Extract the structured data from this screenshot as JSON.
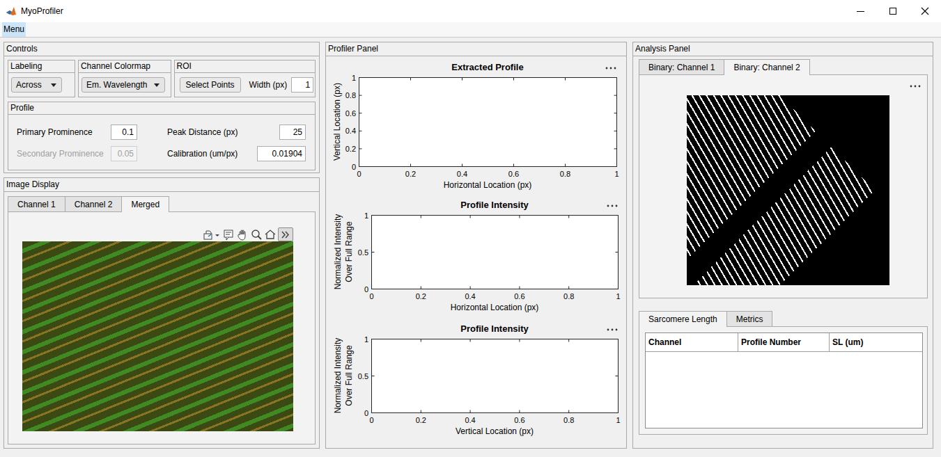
{
  "window": {
    "title": "MyoProfiler"
  },
  "menu": [
    {
      "label": "Menu",
      "selected": true
    }
  ],
  "controls": {
    "title": "Controls",
    "labeling": {
      "title": "Labeling",
      "value": "Across"
    },
    "colormap": {
      "title": "Channel Colormap",
      "value": "Em. Wavelength"
    },
    "roi": {
      "title": "ROI",
      "button": "Select Points",
      "width_label": "Width (px)",
      "width_value": "1"
    },
    "profile": {
      "title": "Profile",
      "fields": [
        {
          "label": "Primary Prominence",
          "value": "0.1",
          "disabled": false
        },
        {
          "label": "Peak Distance (px)",
          "value": "25",
          "disabled": false
        },
        {
          "label": "Secondary Prominence",
          "value": "0.05",
          "disabled": true
        },
        {
          "label": "Calibration (um/px)",
          "value": "0.01904",
          "disabled": false
        }
      ]
    }
  },
  "image_display": {
    "title": "Image Display",
    "tabs": [
      {
        "label": "Channel 1",
        "selected": false
      },
      {
        "label": "Channel 2",
        "selected": false
      },
      {
        "label": "Merged",
        "selected": true
      }
    ]
  },
  "profiler": {
    "title": "Profiler Panel",
    "charts": [
      {
        "title": "Extracted Profile",
        "xlabel": "Horizontal Location (px)",
        "ylabel": [
          "Vertical Location (px)"
        ],
        "xticks": [
          "0",
          "0.2",
          "0.4",
          "0.6",
          "0.8",
          "1"
        ],
        "yticks": [
          "0",
          "0.2",
          "0.4",
          "0.6",
          "0.8",
          "1"
        ],
        "series": []
      },
      {
        "title": "Profile Intensity",
        "xlabel": "Horizontal Location (px)",
        "ylabel": [
          "Normalized Intensity",
          "Over Full Range"
        ],
        "xticks": [
          "0",
          "0.2",
          "0.4",
          "0.6",
          "0.8",
          "1"
        ],
        "yticks": [
          "0",
          "0.5",
          "1"
        ],
        "series": []
      },
      {
        "title": "Profile Intensity",
        "xlabel": "Vertical Location (px)",
        "ylabel": [
          "Normalized Intensity",
          "Over Full Range"
        ],
        "xticks": [
          "0",
          "0.2",
          "0.4",
          "0.6",
          "0.8",
          "1"
        ],
        "yticks": [
          "0",
          "0.5",
          "1"
        ],
        "series": []
      }
    ]
  },
  "analysis": {
    "title": "Analysis Panel",
    "tabs": [
      {
        "label": "Binary: Channel 1",
        "selected": false
      },
      {
        "label": "Binary: Channel 2",
        "selected": true
      }
    ],
    "result_tabs": [
      {
        "label": "Sarcomere Length",
        "selected": true
      },
      {
        "label": "Metrics",
        "selected": false
      }
    ],
    "table": {
      "columns": [
        "Channel",
        "Profile Number",
        "SL (um)"
      ],
      "rows": []
    }
  }
}
